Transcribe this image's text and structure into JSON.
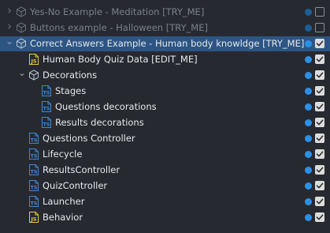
{
  "colors": {
    "background": "#262a30",
    "selected_row": "#2c5584",
    "dot_active": "#2d90e8",
    "dot_inactive": "#1d5e94",
    "ts_icon": "#3f86d6",
    "js_icon": "#e8c844"
  },
  "tree": {
    "items": [
      {
        "label": "Yes-No Example - Meditation [TRY_ME]",
        "icon": "scene-icon",
        "arrow": "collapsed",
        "depth": 0,
        "enabled": false,
        "selected": false,
        "checked": false
      },
      {
        "label": "Buttons example - Halloween [TRY_ME]",
        "icon": "scene-icon",
        "arrow": "collapsed",
        "depth": 0,
        "enabled": false,
        "selected": false,
        "checked": false
      },
      {
        "label": "Correct Answers Example - Human body knowldge [TRY_ME]",
        "icon": "scene-icon",
        "arrow": "expanded",
        "depth": 0,
        "enabled": true,
        "selected": true,
        "checked": true
      },
      {
        "label": "Human Body Quiz Data [EDIT_ME]",
        "icon": "js-file-icon",
        "arrow": "none",
        "depth": 1,
        "enabled": true,
        "selected": false,
        "checked": true
      },
      {
        "label": "Decorations",
        "icon": "scene-icon",
        "arrow": "expanded",
        "depth": 1,
        "enabled": true,
        "selected": false,
        "checked": true
      },
      {
        "label": "Stages",
        "icon": "ts-file-icon",
        "arrow": "none",
        "depth": 2,
        "enabled": true,
        "selected": false,
        "checked": true
      },
      {
        "label": "Questions decorations",
        "icon": "ts-file-icon",
        "arrow": "none",
        "depth": 2,
        "enabled": true,
        "selected": false,
        "checked": true
      },
      {
        "label": "Results decorations",
        "icon": "ts-file-icon",
        "arrow": "none",
        "depth": 2,
        "enabled": true,
        "selected": false,
        "checked": true
      },
      {
        "label": "Questions Controller",
        "icon": "ts-file-icon",
        "arrow": "none",
        "depth": 1,
        "enabled": true,
        "selected": false,
        "checked": true
      },
      {
        "label": "Lifecycle",
        "icon": "ts-file-icon",
        "arrow": "none",
        "depth": 1,
        "enabled": true,
        "selected": false,
        "checked": true
      },
      {
        "label": "ResultsController",
        "icon": "ts-file-icon",
        "arrow": "none",
        "depth": 1,
        "enabled": true,
        "selected": false,
        "checked": true
      },
      {
        "label": "QuizController",
        "icon": "ts-file-icon",
        "arrow": "none",
        "depth": 1,
        "enabled": true,
        "selected": false,
        "checked": true
      },
      {
        "label": "Launcher",
        "icon": "ts-file-icon",
        "arrow": "none",
        "depth": 1,
        "enabled": true,
        "selected": false,
        "checked": true
      },
      {
        "label": "Behavior",
        "icon": "js-file-icon",
        "arrow": "none",
        "depth": 1,
        "enabled": true,
        "selected": false,
        "checked": true
      }
    ]
  }
}
